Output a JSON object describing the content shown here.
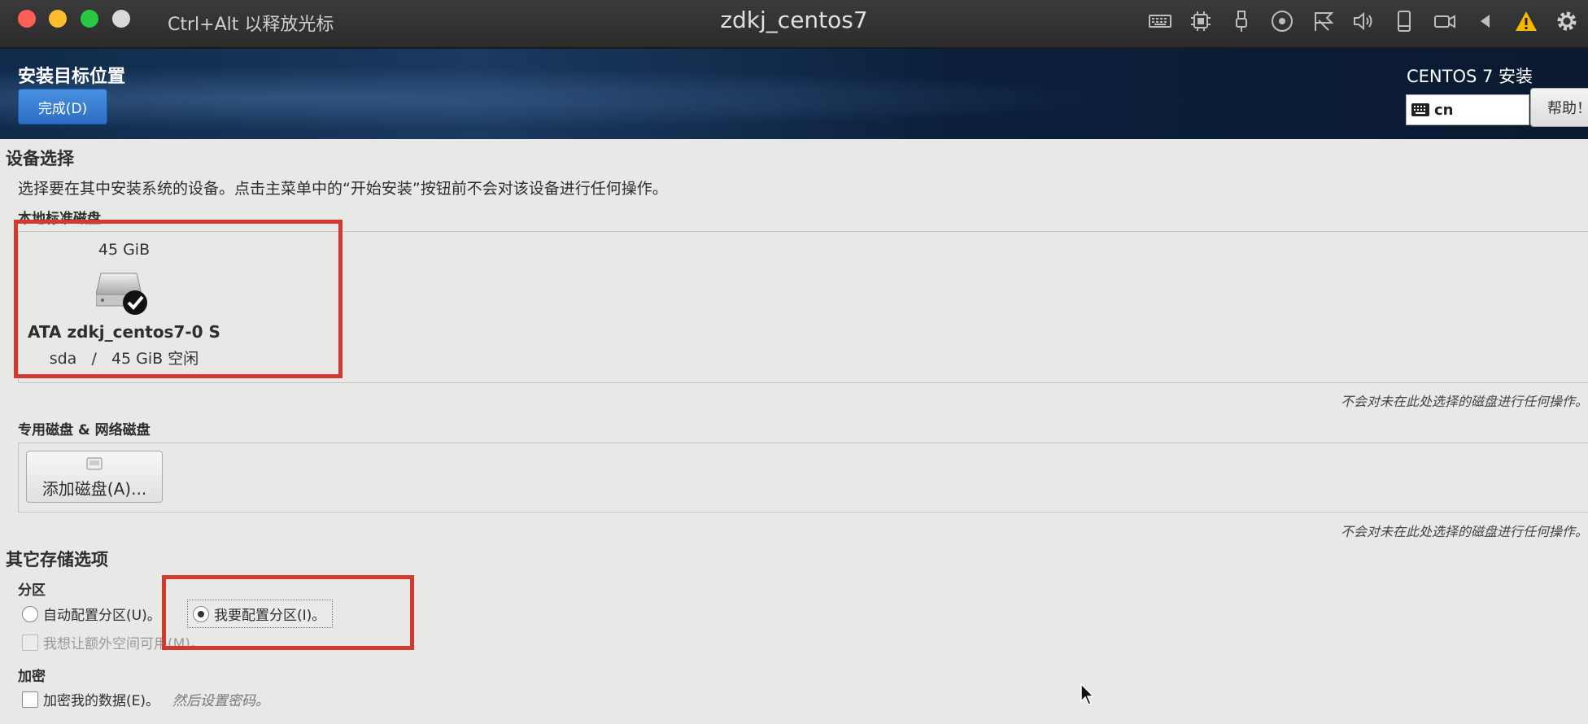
{
  "window": {
    "release_hint": "Ctrl+Alt 以释放光标",
    "title": "zdkj_centos7",
    "toolbar_icons": [
      "keyboard-icon",
      "cpu-icon",
      "usb-icon",
      "optical-disc-icon",
      "network-icon",
      "audio-icon",
      "storage-icon",
      "camera-icon",
      "back-icon",
      "warning-icon",
      "settings-icon"
    ]
  },
  "header": {
    "title": "安装目标位置",
    "done_label": "完成(D)",
    "product": "CENTOS 7 安装",
    "keyboard_layout": "cn",
    "help_label": "帮助！"
  },
  "device_selection": {
    "title": "设备选择",
    "description": "选择要在其中安装系统的设备。点击主菜单中的“开始安装”按钮前不会对该设备进行任何操作。",
    "local_label": "本地标准磁盘",
    "disk": {
      "size": "45 GiB",
      "model": "ATA zdkj_centos7-0 S",
      "info": "sda   /   45 GiB 空闲",
      "selected": true
    },
    "local_note": "不会对未在此处选择的磁盘进行任何操作。",
    "special_label": "专用磁盘 & 网络磁盘",
    "add_disk_label": "添加磁盘(A)...",
    "special_note": "不会对未在此处选择的磁盘进行任何操作。"
  },
  "other_storage": {
    "title": "其它存储选项",
    "partition_label": "分区",
    "auto_partition": "自动配置分区(U)。",
    "manual_partition": "我要配置分区(I)。",
    "extra_space": "我想让额外空间可用(M)。",
    "encryption_label": "加密",
    "encrypt_data": "加密我的数据(E)。",
    "encrypt_hint": "然后设置密码。"
  },
  "colors": {
    "highlight_box": "#d13a2f",
    "done_button": "#3a80d2",
    "header_bg": "#0f2a4a"
  }
}
